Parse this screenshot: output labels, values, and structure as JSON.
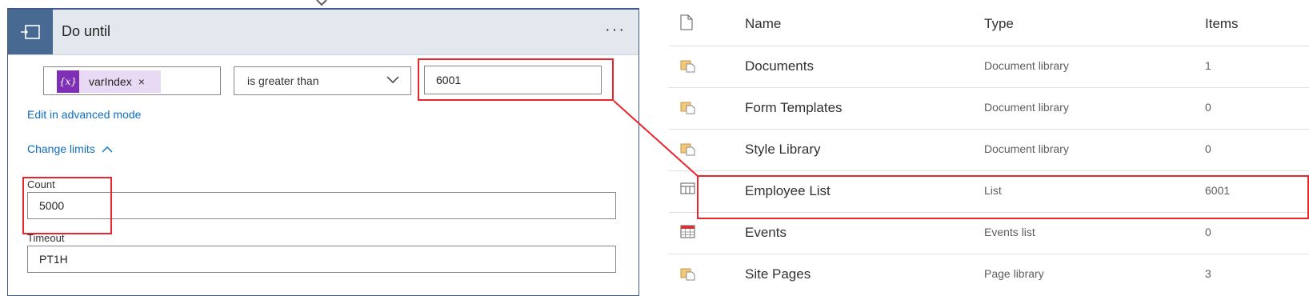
{
  "do_until": {
    "title": "Do until",
    "more_label": "···",
    "condition": {
      "token_icon": "{x}",
      "token_label": "varIndex",
      "token_remove": "×",
      "operator": "is greater than",
      "value": "6001"
    },
    "edit_advanced_label": "Edit in advanced mode",
    "change_limits_label": "Change limits",
    "count_label": "Count",
    "count_value": "5000",
    "timeout_label": "Timeout",
    "timeout_value": "PT1H"
  },
  "site_contents": {
    "columns": {
      "name": "Name",
      "type": "Type",
      "items": "Items"
    },
    "rows": [
      {
        "name": "Documents",
        "type": "Document library",
        "items": "1",
        "icon": "document-library-icon"
      },
      {
        "name": "Form Templates",
        "type": "Document library",
        "items": "0",
        "icon": "document-library-icon"
      },
      {
        "name": "Style Library",
        "type": "Document library",
        "items": "0",
        "icon": "document-library-icon"
      },
      {
        "name": "Employee List",
        "type": "List",
        "items": "6001",
        "icon": "list-icon"
      },
      {
        "name": "Events",
        "type": "Events list",
        "items": "0",
        "icon": "calendar-icon"
      },
      {
        "name": "Site Pages",
        "type": "Page library",
        "items": "3",
        "icon": "document-library-icon"
      }
    ]
  },
  "colors": {
    "highlight": "#e8262c",
    "card_border": "#41598b",
    "card_icon_bg": "#486991",
    "token_bg": "#e8d9f5",
    "token_icon_bg": "#7e2fb5",
    "link": "#0f6cbd"
  }
}
